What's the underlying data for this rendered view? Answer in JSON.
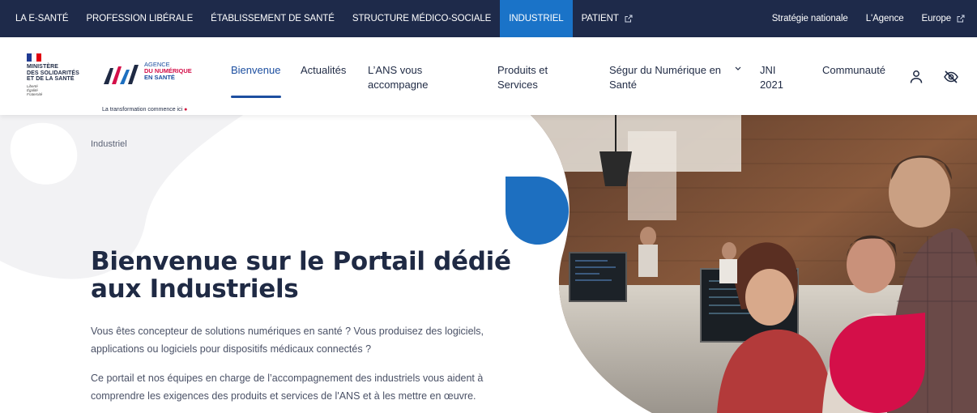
{
  "topbar": {
    "left_items": [
      {
        "label": "LA E-SANTÉ",
        "active": false,
        "external": false
      },
      {
        "label": "PROFESSION LIBÉRALE",
        "active": false,
        "external": false
      },
      {
        "label": "ÉTABLISSEMENT DE SANTÉ",
        "active": false,
        "external": false
      },
      {
        "label": "STRUCTURE MÉDICO-SOCIALE",
        "active": false,
        "external": false
      },
      {
        "label": "INDUSTRIEL",
        "active": true,
        "external": false
      },
      {
        "label": "PATIENT",
        "active": false,
        "external": true
      }
    ],
    "right_items": [
      {
        "label": "Stratégie nationale",
        "external": false
      },
      {
        "label": "L'Agence",
        "external": false
      },
      {
        "label": "Europe",
        "external": true
      }
    ]
  },
  "header": {
    "ministere": {
      "lines": [
        "MINISTÈRE",
        "DES SOLIDARITÉS",
        "ET DE LA SANTÉ"
      ],
      "motto": [
        "Liberté",
        "Égalité",
        "Fraternité"
      ]
    },
    "ans": {
      "lines": [
        "AGENCE",
        "DU NUMÉRIQUE",
        "EN SANTÉ"
      ],
      "tagline": "La transformation commence ici"
    },
    "nav": [
      {
        "label": "Bienvenue",
        "active": true
      },
      {
        "label": "Actualités",
        "active": false
      },
      {
        "label": "L’ANS vous accompagne",
        "active": false
      },
      {
        "label": "Produits et Services",
        "active": false
      },
      {
        "label": "Ségur du Numérique en Santé",
        "active": false,
        "dropdown": true
      },
      {
        "label": "JNI 2021",
        "active": false
      },
      {
        "label": "Communauté",
        "active": false
      }
    ],
    "icons": [
      "user-icon",
      "eye-off-icon",
      "chevron-down-icon",
      "external-link-icon"
    ]
  },
  "hero": {
    "breadcrumb": "Industriel",
    "title": "Bienvenue sur le Portail dédié aux Industriels",
    "p1": "Vous êtes concepteur de solutions numériques en santé ? Vous produisez des logiciels, applications ou logiciels pour dispositifs médicaux connectés ?",
    "p2": "Ce portail et nos équipes en charge de l’accompagnement des industriels vous aident à comprendre les exigences des produits et services de l'ANS et à les mettre en œuvre."
  },
  "colors": {
    "topbar_bg": "#1e2a4a",
    "active_tab": "#1a73c8",
    "text_dark": "#1f2a44",
    "accent_blue": "#1d6fc0",
    "accent_red": "#d40f49"
  }
}
